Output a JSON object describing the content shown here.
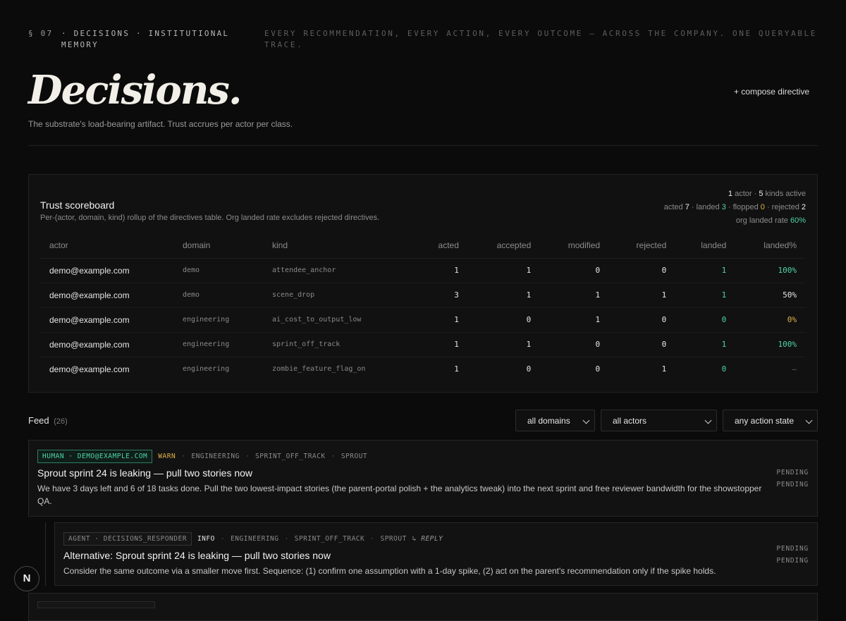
{
  "header": {
    "section": "§ 07",
    "eyebrow_title": "· DECISIONS · INSTITUTIONAL MEMORY",
    "eyebrow_tagline": "EVERY RECOMMENDATION, EVERY ACTION, EVERY OUTCOME — ACROSS THE COMPANY. ONE QUERYABLE TRACE.",
    "title": "Decisions.",
    "subtitle": "The substrate's load-bearing artifact. Trust accrues per actor per class.",
    "compose_label": "+ compose directive"
  },
  "scoreboard": {
    "title": "Trust scoreboard",
    "description": "Per-(actor, domain, kind) rollup of the directives table. Org landed rate excludes rejected directives.",
    "stats": {
      "actors": "1",
      "actor_label": "actor ·",
      "kinds": "5",
      "kinds_label": "kinds active",
      "acted_label": "acted",
      "acted": "7",
      "landed_label": "· landed",
      "landed": "3",
      "flopped_label": "· flopped",
      "flopped": "0",
      "rejected_label": "· rejected",
      "rejected": "2",
      "org_rate_label": "org landed rate",
      "org_rate": "60%"
    },
    "columns": [
      "actor",
      "domain",
      "kind",
      "acted",
      "accepted",
      "modified",
      "rejected",
      "landed",
      "landed%"
    ],
    "rows": [
      {
        "actor": "demo@example.com",
        "domain": "demo",
        "kind": "attendee_anchor",
        "acted": "1",
        "accepted": "1",
        "modified": "0",
        "rejected": "0",
        "landed": "1",
        "landed_pct": "100%",
        "pct_color": "#4fd4a4"
      },
      {
        "actor": "demo@example.com",
        "domain": "demo",
        "kind": "scene_drop",
        "acted": "3",
        "accepted": "1",
        "modified": "1",
        "rejected": "1",
        "landed": "1",
        "landed_pct": "50%",
        "pct_color": "#e6e6e6"
      },
      {
        "actor": "demo@example.com",
        "domain": "engineering",
        "kind": "ai_cost_to_output_low",
        "acted": "1",
        "accepted": "0",
        "modified": "1",
        "rejected": "0",
        "landed": "0",
        "landed_pct": "0%",
        "pct_color": "#e0b14a"
      },
      {
        "actor": "demo@example.com",
        "domain": "engineering",
        "kind": "sprint_off_track",
        "acted": "1",
        "accepted": "1",
        "modified": "0",
        "rejected": "0",
        "landed": "1",
        "landed_pct": "100%",
        "pct_color": "#4fd4a4"
      },
      {
        "actor": "demo@example.com",
        "domain": "engineering",
        "kind": "zombie_feature_flag_on",
        "acted": "1",
        "accepted": "0",
        "modified": "0",
        "rejected": "1",
        "landed": "0",
        "landed_pct": "—",
        "pct_color": "#6a6a6a"
      }
    ],
    "landed_color": "#4fd4a4"
  },
  "feed": {
    "label": "Feed",
    "count": "(26)",
    "filters": {
      "domain": "all domains",
      "actor": "all actors",
      "action_state": "any action state"
    },
    "items": [
      {
        "badge": "HUMAN · DEMO@EXAMPLE.COM",
        "level": "WARN",
        "domain": "ENGINEERING",
        "kind": "SPRINT_OFF_TRACK",
        "project": "SPROUT",
        "title": "Sprout sprint 24 is leaking — pull two stories now",
        "body": "We have 3 days left and 6 of 18 tasks done. Pull the two lowest-impact stories (the parent-portal polish + the analytics tweak) into the next sprint and free reviewer bandwidth for the showstopper QA.",
        "state1": "PENDING",
        "state2": "PENDING"
      },
      {
        "badge": "AGENT · DECISIONS_RESPONDER",
        "level": "INFO",
        "domain": "ENGINEERING",
        "kind": "SPRINT_OFF_TRACK",
        "project": "SPROUT",
        "reply_label": "↳ REPLY",
        "title": "Alternative: Sprout sprint 24 is leaking — pull two stories now",
        "body": "Consider the same outcome via a smaller move first. Sequence: (1) confirm one assumption with a 1-day spike, (2) act on the parent's recommendation only if the spike holds.",
        "state1": "PENDING",
        "state2": "PENDING"
      }
    ]
  },
  "fab_label": "N"
}
